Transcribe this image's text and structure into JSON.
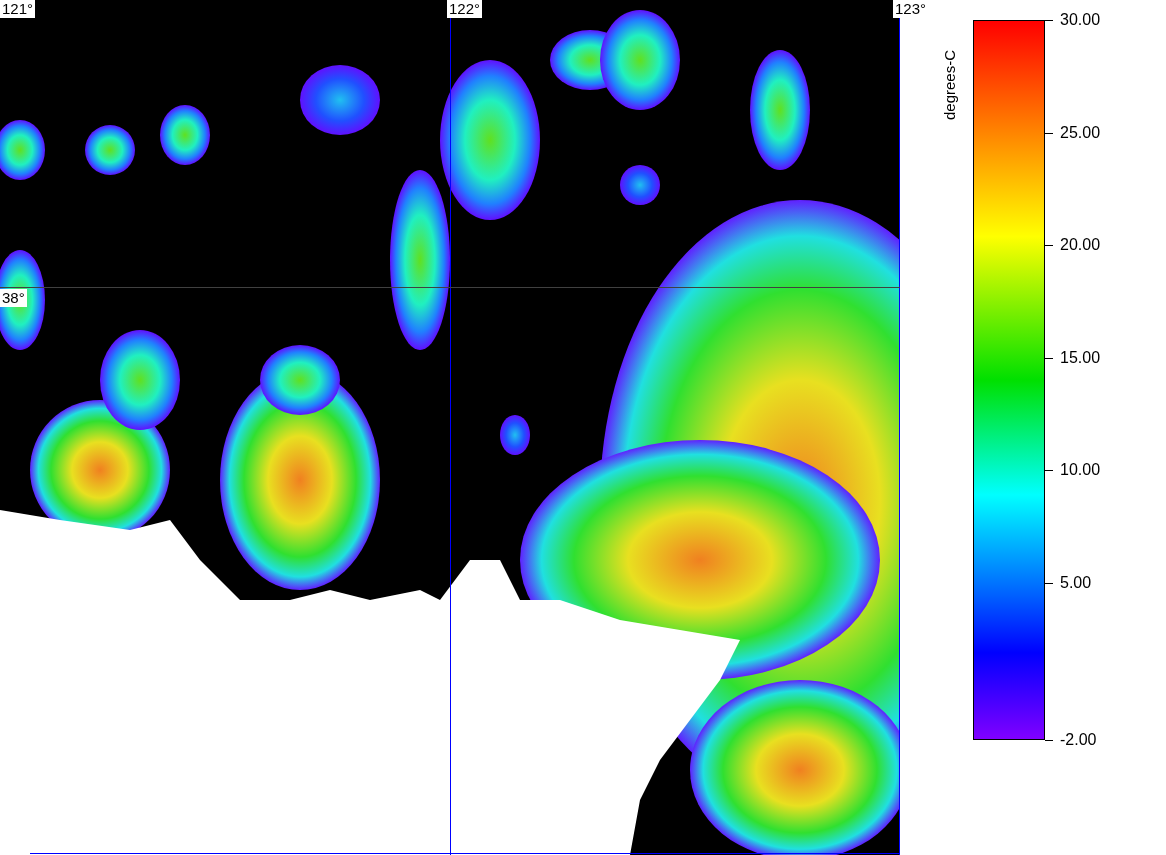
{
  "map": {
    "longitude_labels": [
      "121°",
      "122°",
      "123°"
    ],
    "latitude_labels": [
      "38°"
    ]
  },
  "colorbar": {
    "title": "degrees-C",
    "ticks": [
      "30.00",
      "25.00",
      "20.00",
      "15.00",
      "10.00",
      "5.00",
      "-2.00"
    ]
  }
}
